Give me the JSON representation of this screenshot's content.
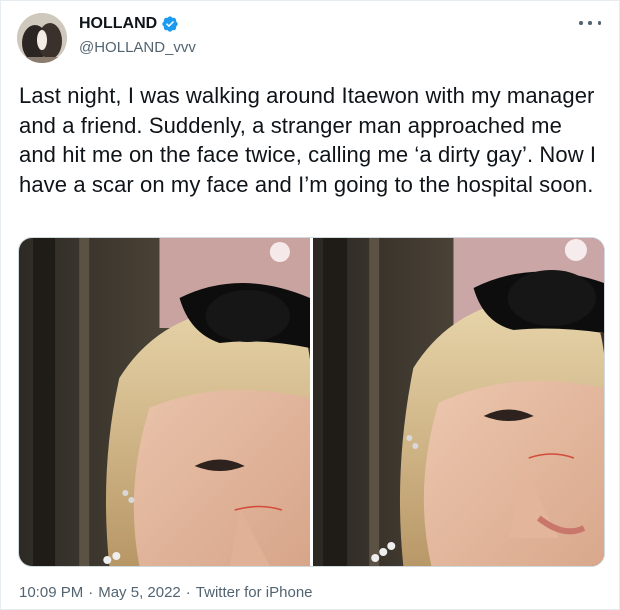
{
  "author": {
    "display_name": "HOLLAND",
    "handle": "@HOLLAND_vvv",
    "verified_icon": "verified-badge-icon"
  },
  "tweet": {
    "text": "Last night, I was walking around Itaewon with my manager and a friend. Suddenly, a stranger man approached me and hit me on the face twice, calling me ‘a dirty gay’. Now I have a scar on my face and I’m going to the hospital soon."
  },
  "meta": {
    "time": "10:09 PM",
    "sep1": "·",
    "date": "May 5, 2022",
    "sep2": "·",
    "source": "Twitter for iPhone"
  },
  "colors": {
    "text": "#0f1419",
    "secondary": "#536471",
    "verified": "#1d9bf0",
    "border": "#cfd9de"
  }
}
